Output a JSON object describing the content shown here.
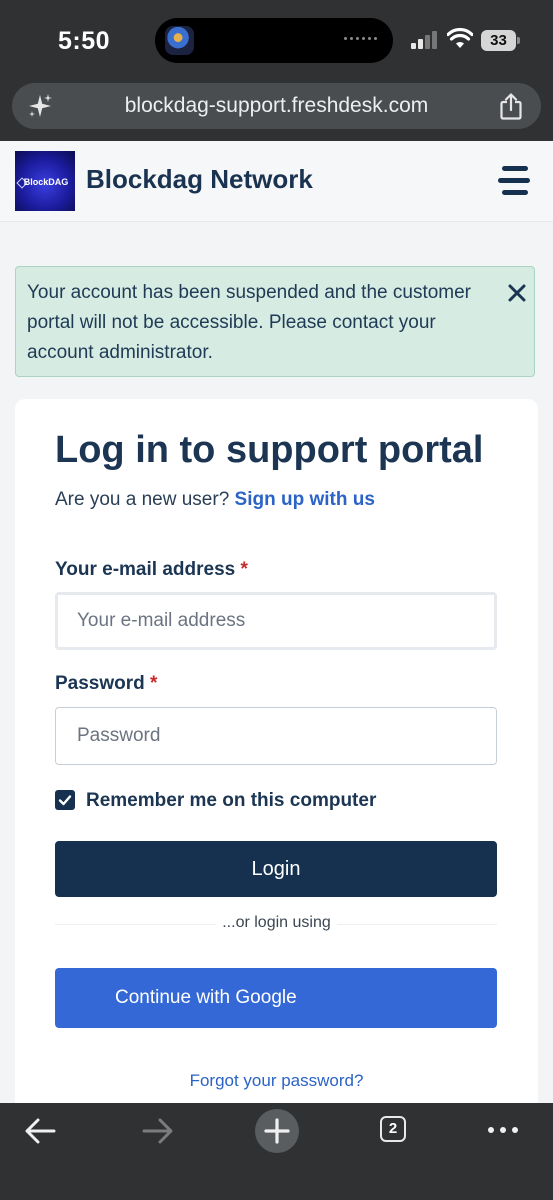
{
  "status_bar": {
    "time": "5:50",
    "battery": "33"
  },
  "browser": {
    "url": "blockdag-support.freshdesk.com",
    "tabs_count": "2"
  },
  "header": {
    "logo_text": "BlockDAG",
    "site_name": "Blockdag Network"
  },
  "alert": {
    "message": "Your account has been suspended and the customer portal will not be accessible. Please contact your account administrator."
  },
  "login": {
    "title": "Log in to support portal",
    "new_user_prompt": "Are you a new user?",
    "signup_link": "Sign up with us",
    "email_label": "Your e-mail address",
    "email_placeholder": "Your e-mail address",
    "email_value": "",
    "password_label": "Password",
    "password_placeholder": "Password",
    "password_value": "",
    "required_marker": "*",
    "remember_label": "Remember me on this computer",
    "remember_checked": true,
    "login_button": "Login",
    "or_login_using": "...or login using",
    "google_button": "Continue with Google",
    "forgot_password": "Forgot your password?"
  },
  "colors": {
    "primary_navy": "#163150",
    "link_blue": "#2b63c6",
    "google_blue": "#3368d6",
    "alert_bg": "#d6ebe2",
    "required_red": "#c62a2a"
  }
}
